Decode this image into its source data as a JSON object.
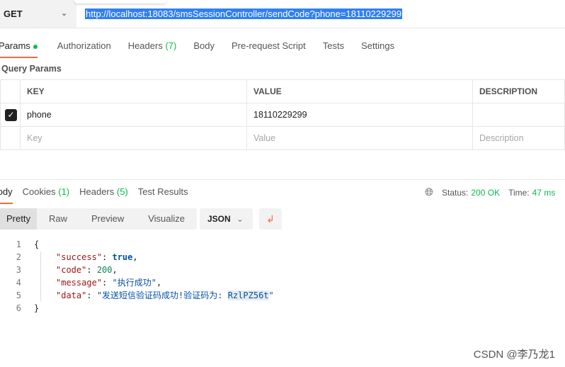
{
  "request": {
    "method": "GET",
    "url": "http://localhost:18083/smsSessionController/sendCode?phone=18110229299"
  },
  "req_tabs": [
    {
      "label": "Params",
      "active": true,
      "dot": true
    },
    {
      "label": "Authorization"
    },
    {
      "label": "Headers",
      "count": "(7)"
    },
    {
      "label": "Body"
    },
    {
      "label": "Pre-request Script"
    },
    {
      "label": "Tests"
    },
    {
      "label": "Settings"
    }
  ],
  "query_params": {
    "title": "Query Params",
    "headers": [
      "KEY",
      "VALUE",
      "DESCRIPTION"
    ],
    "rows": [
      {
        "checked": true,
        "key": "phone",
        "value": "18110229299",
        "description": ""
      }
    ],
    "placeholder": {
      "key": "Key",
      "value": "Value",
      "description": "Description"
    }
  },
  "resp_tabs": [
    {
      "label": "Body",
      "active": true
    },
    {
      "label": "Cookies",
      "count": "(1)"
    },
    {
      "label": "Headers",
      "count": "(5)"
    },
    {
      "label": "Test Results"
    }
  ],
  "status": {
    "status_label": "Status:",
    "status": "200 OK",
    "time_label": "Time:",
    "time": "47 ms"
  },
  "views": [
    "Pretty",
    "Raw",
    "Preview",
    "Visualize"
  ],
  "format": "JSON",
  "code": {
    "line_numbers": [
      "1",
      "2",
      "3",
      "4",
      "5",
      "6"
    ],
    "open": "{",
    "close": "}",
    "success_key": "\"success\"",
    "success_val": "true",
    "code_key": "\"code\"",
    "code_val": "200",
    "message_key": "\"message\"",
    "message_val": "\"执行成功\"",
    "data_key": "\"data\"",
    "data_val": "\"发送短信验证码成功!验证码为: ",
    "data_code": "RzlPZ56t",
    "data_end": "\""
  },
  "watermark": "CSDN @李乃龙1",
  "colors": {
    "accent": "#f26b3a",
    "success": "#0cbb52",
    "selection": "#2f7ff5"
  }
}
